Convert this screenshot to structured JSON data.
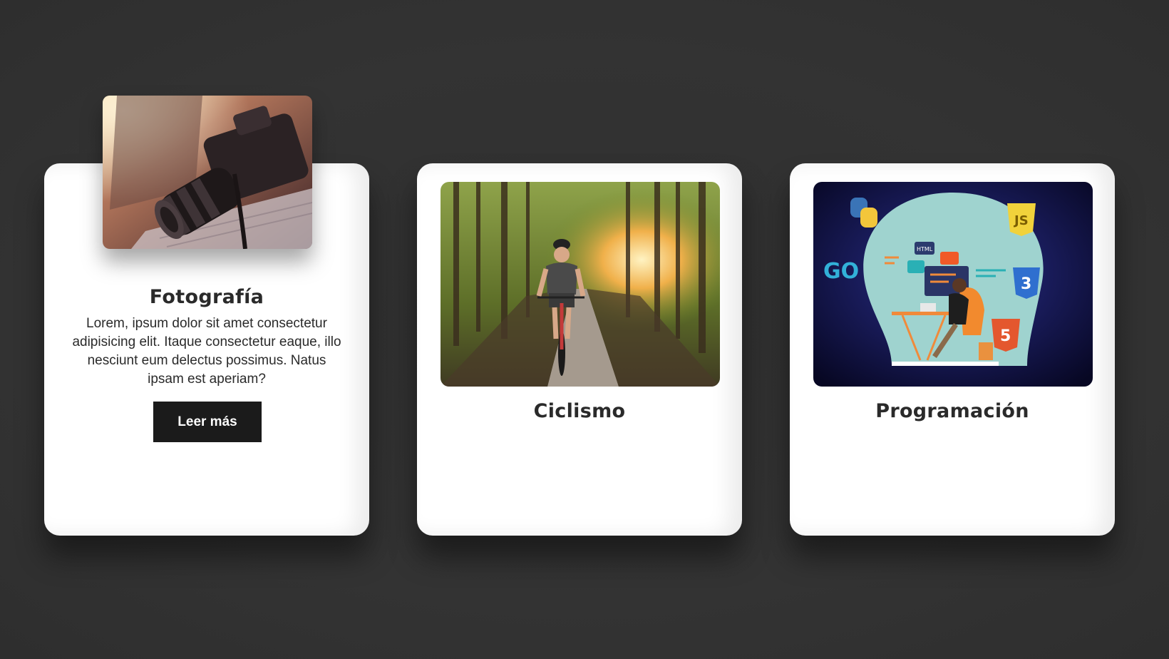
{
  "cards": [
    {
      "title": "Fotografía",
      "description": "Lorem, ipsum dolor sit amet consectetur adipisicing elit. Itaque consectetur eaque, illo nesciunt eum delectus possimus. Natus ipsam est aperiam?",
      "button_label": "Leer más",
      "image": "camera-on-laptop-photo",
      "expanded": true
    },
    {
      "title": "Ciclismo",
      "image": "cyclist-forest-road-photo",
      "expanded": false
    },
    {
      "title": "Programación",
      "image": "programming-illustration",
      "expanded": false,
      "image_labels": {
        "go": "GO",
        "html": "HTML",
        "js": "JS",
        "css": "3",
        "html5": "5"
      }
    }
  ],
  "colors": {
    "background": "#333333",
    "card": "#ffffff",
    "button": "#1b1b1b",
    "text": "#2a2a2a"
  }
}
